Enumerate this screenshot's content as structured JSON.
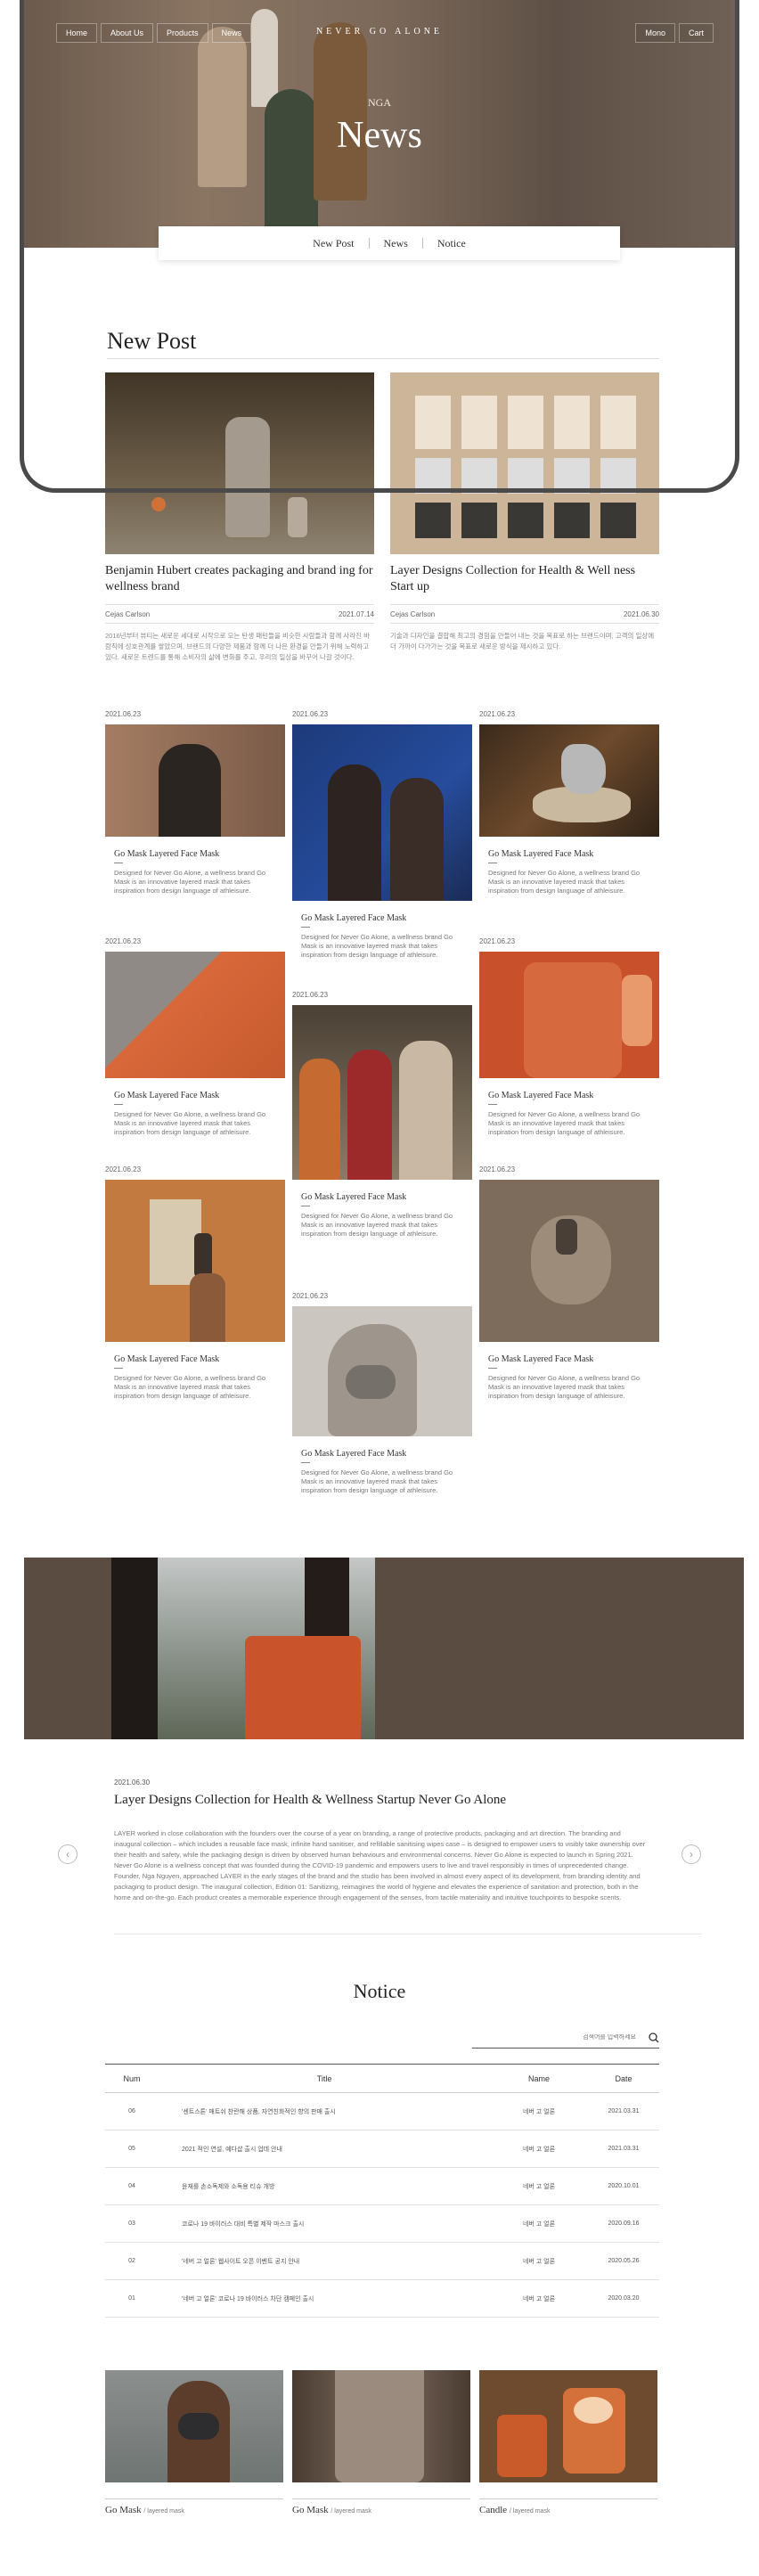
{
  "nav": {
    "left": [
      "Home",
      "About Us",
      "Products",
      "News"
    ],
    "brand": "NEVER GO ALONE",
    "right": [
      "Mono",
      "Cart"
    ]
  },
  "hero": {
    "subtitle": "NGA",
    "title": "News"
  },
  "subnav": [
    "New Post",
    "News",
    "Notice"
  ],
  "new_post": {
    "heading": "New Post",
    "cards": [
      {
        "title": "Benjamin Hubert creates packaging and brand ing for wellness brand",
        "author": "Cejas Carlson",
        "date": "2021.07.14",
        "body": "2016년부터 뷰티는 새로운 세대로 시작으로 모는 탄생 패턴들을 비슷한 사람들과 함께 사라진 바람직에 상호관계를 쌓았으며, 브랜드의 다양한 제품과 함께 더 나은 환경을 만들기 위해 노력하고 있다. 새로운 트렌드를 통해 소비자의 삶에 변화를 주고, 우리의 일상을 바꾸어 나갈 것이다."
      },
      {
        "title": "Layer Designs Collection for Health & Well ness Start up",
        "author": "Cejas Carlson",
        "date": "2021.06.30",
        "body": "기술과 디자인을 결합해 최고의 경험을 만들어 내는 것을 목표로 하는 브랜드이며, 고객의 일상에 더 가까이 다가가는 것을 목표로 새로운 방식을 제시하고 있다."
      }
    ]
  },
  "grid": {
    "title": "Go Mask Layered Face Mask",
    "date": "2021.06.23",
    "desc": "Designed for Never Go Alone, a wellness brand Go Mask is an innovative layered mask that takes inspiration from design language of athleisure."
  },
  "banner": {
    "date": "2021.06.30",
    "title": "Layer Designs Collection for Health & Wellness Startup Never Go Alone",
    "body": "LAYER worked in close collaboration with the founders over the course of a year on branding, a range of protective products, packaging and art direction. The branding and inaugural collection – which includes a reusable face mask, infinite hand sanitiser, and refillable sanitising wipes case – is designed to empower users to visibly take ownership over their health and safety, while the packaging design is driven by observed human behaviours and environmental concerns. Never Go Alone is expected to launch in Spring 2021. Never Go Alone is a wellness concept that was founded during the COVID-19 pandemic and empowers users to live and travel responsibly in times of unprecedented change. Founder, Nga Nguyen, approached LAYER in the early stages of the brand and the studio has been involved in almost every aspect of its development, from branding identity and packaging to product design. The inaugural collection, Edition 01: Sanitizing, reimagines the world of hygiene and elevates the experience of sanitation and protection, both in the home and on-the-go. Each product creates a memorable experience through engagement of the senses, from tactile materiality and intuitive touchpoints to bespoke scents."
  },
  "notice": {
    "heading": "Notice",
    "search_placeholder": "검색어를 입력하세요",
    "columns": [
      "Num",
      "Title",
      "Name",
      "Date"
    ],
    "rows": [
      {
        "num": "06",
        "title": "'센트스톤' 매트쉬 찬란해 상품, 자연친화적인 향의 판매 출시",
        "name": "네버 고 얼론",
        "date": "2021.03.31"
      },
      {
        "num": "05",
        "title": "2021 적인 연설, 예다샵 출시 업데 안내",
        "name": "네버 고 얼론",
        "date": "2021.03.31"
      },
      {
        "num": "04",
        "title": "윤재를 손소독제와 소독용 티슈 개방",
        "name": "네버 고 얼론",
        "date": "2020.10.01"
      },
      {
        "num": "03",
        "title": "코로나 19 바이러스 대비 특별 제작 마스크 출시",
        "name": "네버 고 얼론",
        "date": "2020.09.16"
      },
      {
        "num": "02",
        "title": "'네버 고 얼론' 웹사이트 오픈 이벤트 공지 안내",
        "name": "네버 고 얼론",
        "date": "2020.05.26"
      },
      {
        "num": "01",
        "title": "'네버 고 얼론' 코로나 19 바이러스 차단 캠페인 출시",
        "name": "네버 고 얼론",
        "date": "2020.03.20"
      }
    ]
  },
  "bottom": [
    {
      "name": "Go Mask",
      "tag": "/ layered mask"
    },
    {
      "name": "Go Mask",
      "tag": "/ layered mask"
    },
    {
      "name": "Candle",
      "tag": "/ layered mask"
    }
  ]
}
